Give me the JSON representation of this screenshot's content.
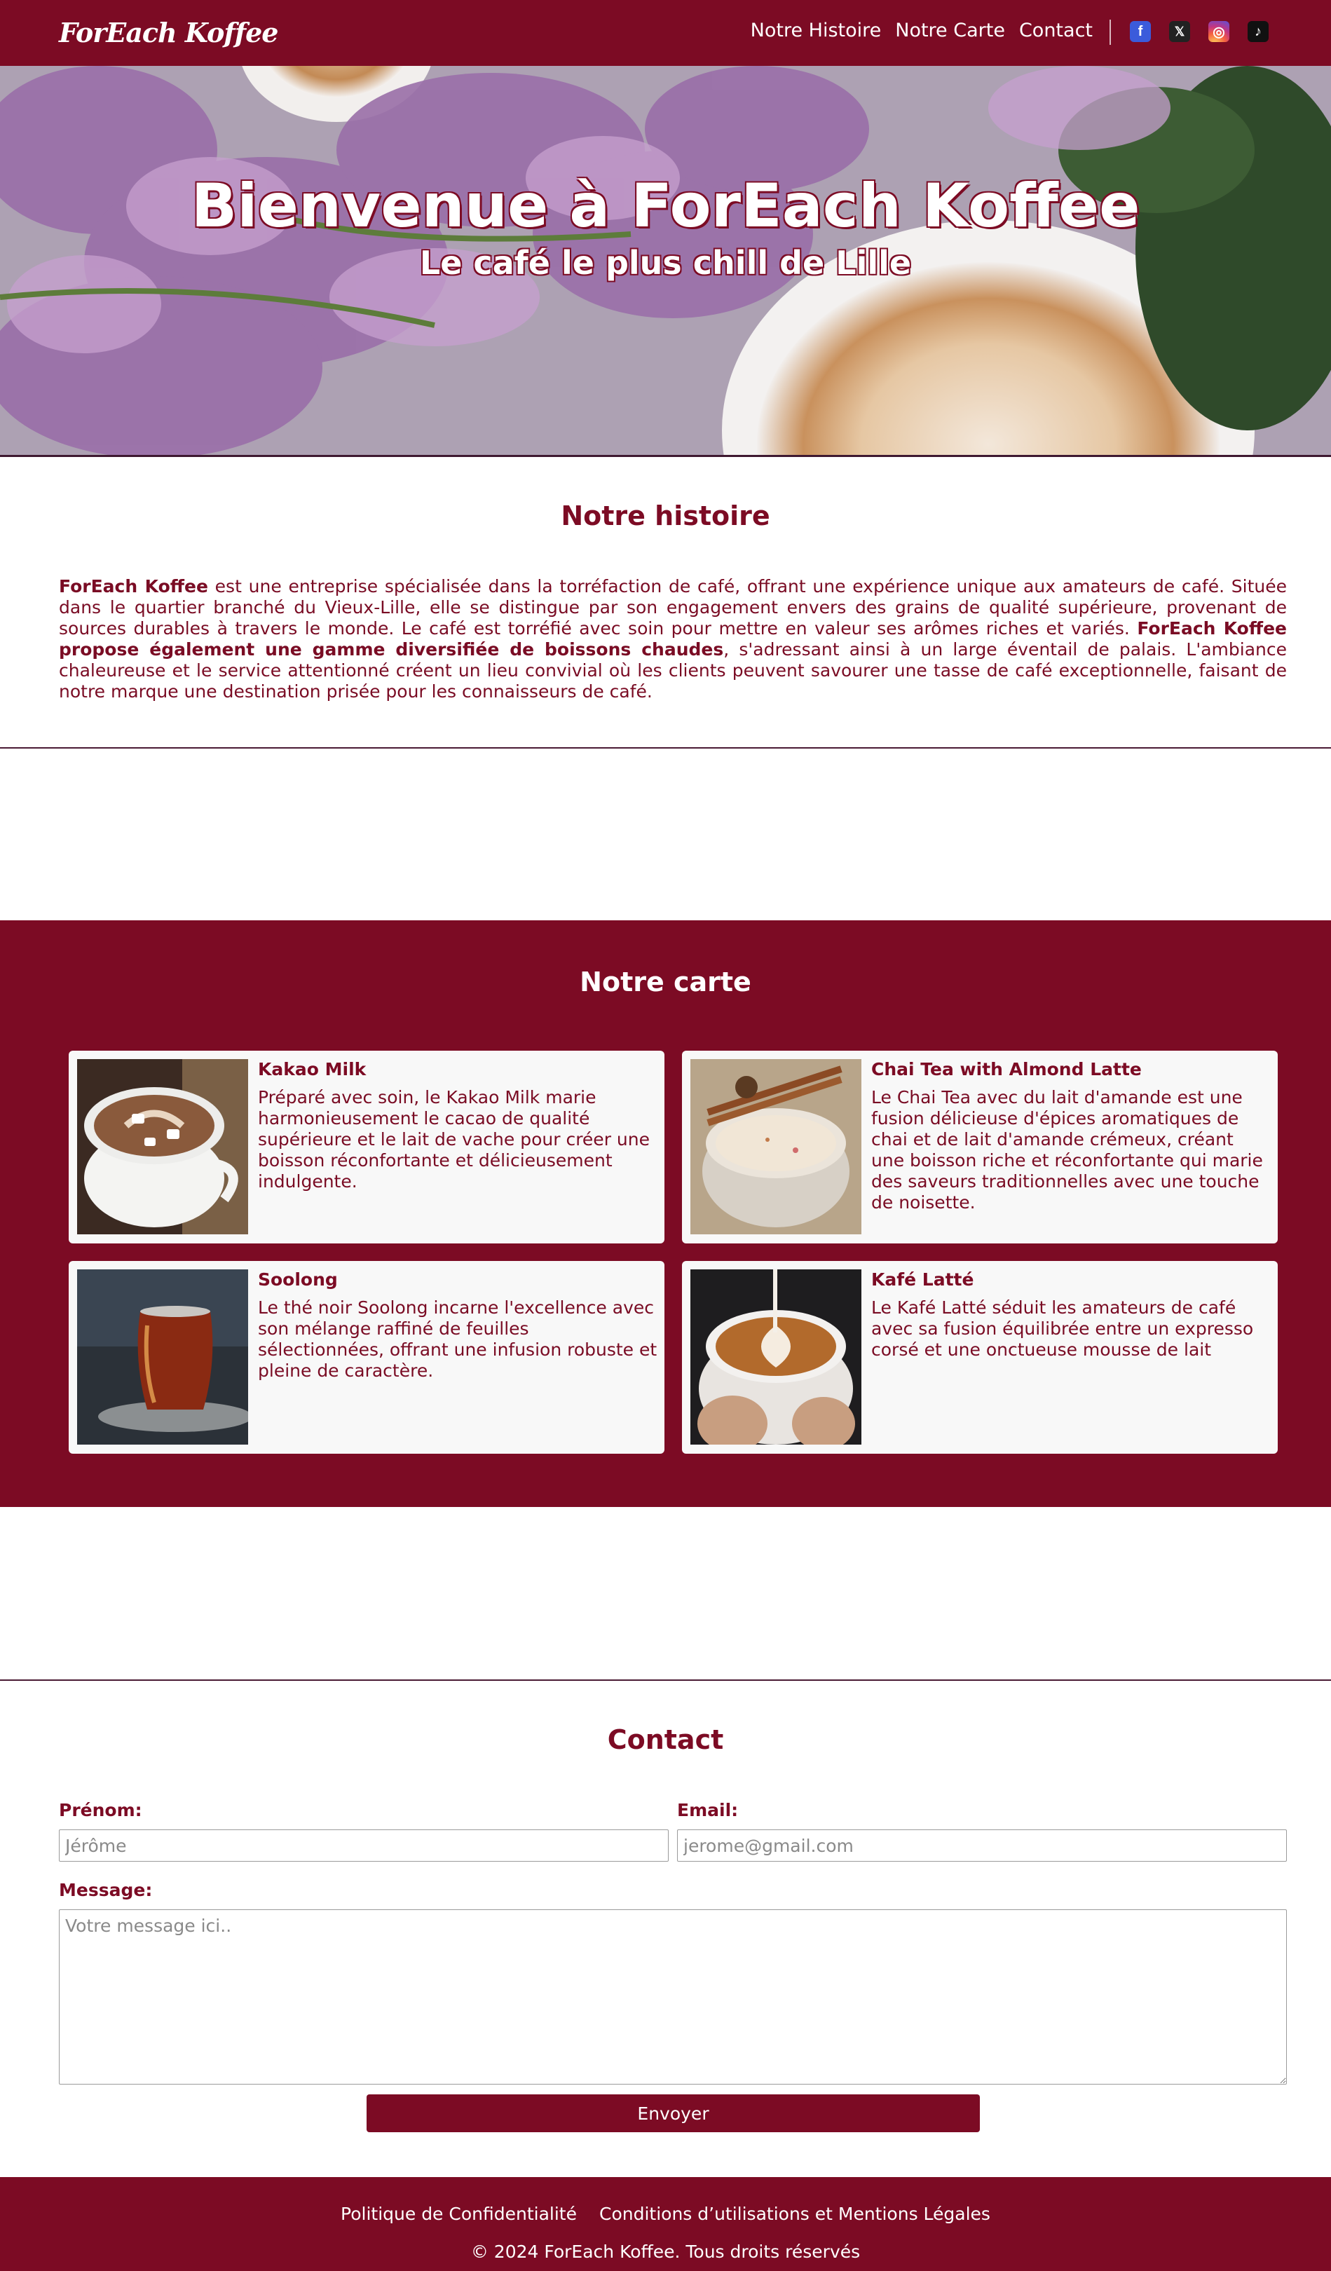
{
  "header": {
    "logo": "ForEach Koffee",
    "nav": [
      "Notre Histoire",
      "Notre Carte",
      "Contact"
    ],
    "socials": [
      {
        "icon": "facebook-icon",
        "glyph": "f"
      },
      {
        "icon": "x-twitter-icon",
        "glyph": "𝕏"
      },
      {
        "icon": "instagram-icon",
        "glyph": "◎"
      },
      {
        "icon": "tiktok-icon",
        "glyph": "♪"
      }
    ]
  },
  "hero": {
    "title": "Bienvenue à ForEach Koffee",
    "subtitle": "Le café le plus chill de Lille"
  },
  "histoire": {
    "title": "Notre histoire",
    "brand": "ForEach Koffee",
    "text_1": " est une entreprise spécialisée dans la torréfaction de café, offrant une expérience unique aux amateurs de café. Située dans le quartier branché du Vieux-Lille, elle se distingue par son engagement envers des grains de qualité supérieure, provenant de sources durables à travers le monde. Le café est torréfié avec soin pour mettre en valeur ses arômes riches et variés. ",
    "bold_2": "ForEach Koffee propose également une gamme diversifiée de boissons chaudes",
    "text_3": ", s'adressant ainsi à un large éventail de palais. L'ambiance chaleureuse et le service attentionné créent un lieu convivial où les clients peuvent savourer une tasse de café exceptionnelle, faisant de notre marque une destination prisée pour les connaisseurs de café."
  },
  "carte": {
    "title": "Notre carte",
    "items": [
      {
        "name": "Kakao Milk",
        "desc": "Préparé avec soin, le Kakao Milk marie harmonieusement le cacao de qualité supérieure et le lait de vache pour créer une boisson réconfortante et délicieusement indulgente."
      },
      {
        "name": "Chai Tea with Almond Latte",
        "desc": "Le Chai Tea avec du lait d'amande est une fusion délicieuse d'épices aromatiques de chai et de lait d'amande crémeux, créant une boisson riche et réconfortante qui marie des saveurs traditionnelles avec une touche de noisette."
      },
      {
        "name": "Soolong",
        "desc": "Le thé noir Soolong incarne l'excellence avec son mélange raffiné de feuilles sélectionnées, offrant une infusion robuste et pleine de caractère."
      },
      {
        "name": "Kafé Latté",
        "desc": "Le Kafé Latté séduit les amateurs de café avec sa fusion équilibrée entre un expresso corsé et une onctueuse mousse de lait"
      }
    ]
  },
  "contact": {
    "title": "Contact",
    "prenom_label": "Prénom:",
    "prenom_placeholder": "Jérôme",
    "email_label": "Email:",
    "email_placeholder": "jerome@gmail.com",
    "message_label": "Message:",
    "message_placeholder": "Votre message ici..",
    "submit": "Envoyer"
  },
  "footer": {
    "links": [
      "Politique de Confidentialité",
      "Conditions d’utilisations et Mentions Légales"
    ],
    "copyright": "© 2024 ForEach Koffee. Tous droits réservés"
  },
  "colors": {
    "brand": "#7c0b24",
    "card_bg": "#f8f8f8",
    "text": "#7a0c24"
  }
}
